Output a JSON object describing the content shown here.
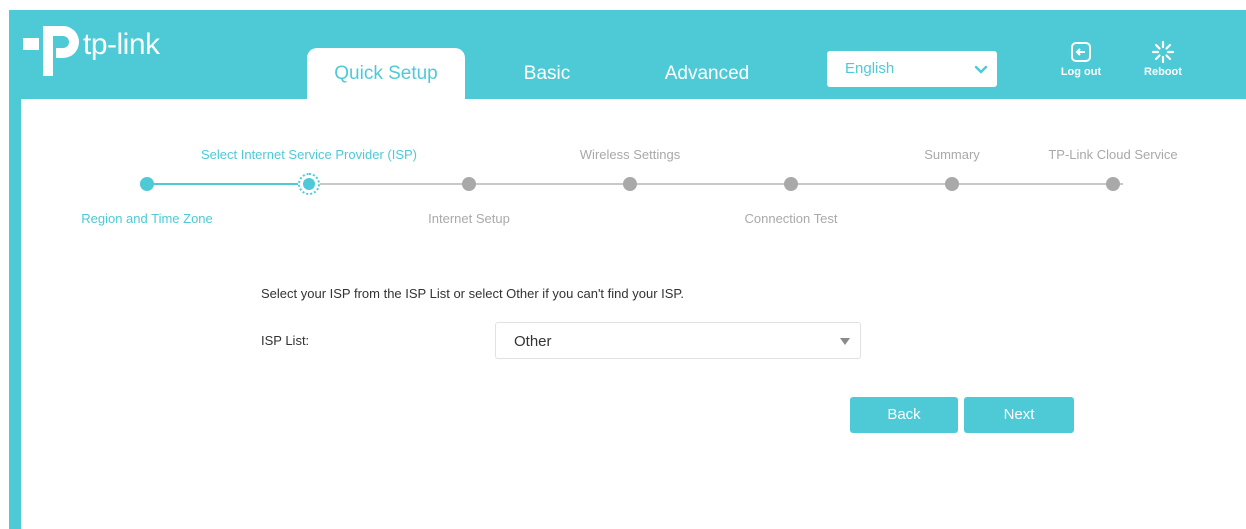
{
  "brand": {
    "logo_text": "tp-link",
    "accent": "#4ecad6"
  },
  "nav": {
    "tabs": [
      {
        "label": "Quick Setup",
        "active": true
      },
      {
        "label": "Basic",
        "active": false
      },
      {
        "label": "Advanced",
        "active": false
      }
    ]
  },
  "header": {
    "language": {
      "selected": "English",
      "icon": "chevron-down-icon"
    },
    "logout": {
      "label": "Log out",
      "icon": "logout-icon"
    },
    "reboot": {
      "label": "Reboot",
      "icon": "reboot-icon"
    }
  },
  "progress": {
    "steps": [
      {
        "label": "Region and Time Zone",
        "state": "done"
      },
      {
        "label": "Select Internet Service Provider (ISP)",
        "state": "current"
      },
      {
        "label": "Internet Setup",
        "state": "pending"
      },
      {
        "label": "Wireless Settings",
        "state": "pending"
      },
      {
        "label": "Connection Test",
        "state": "pending"
      },
      {
        "label": "Summary",
        "state": "pending"
      },
      {
        "label": "TP-Link Cloud Service",
        "state": "pending"
      }
    ]
  },
  "form": {
    "instruction": "Select your ISP from the ISP List or select Other if you can't find your ISP.",
    "isp_label": "ISP List:",
    "isp_selected": "Other"
  },
  "actions": {
    "back": "Back",
    "next": "Next"
  }
}
